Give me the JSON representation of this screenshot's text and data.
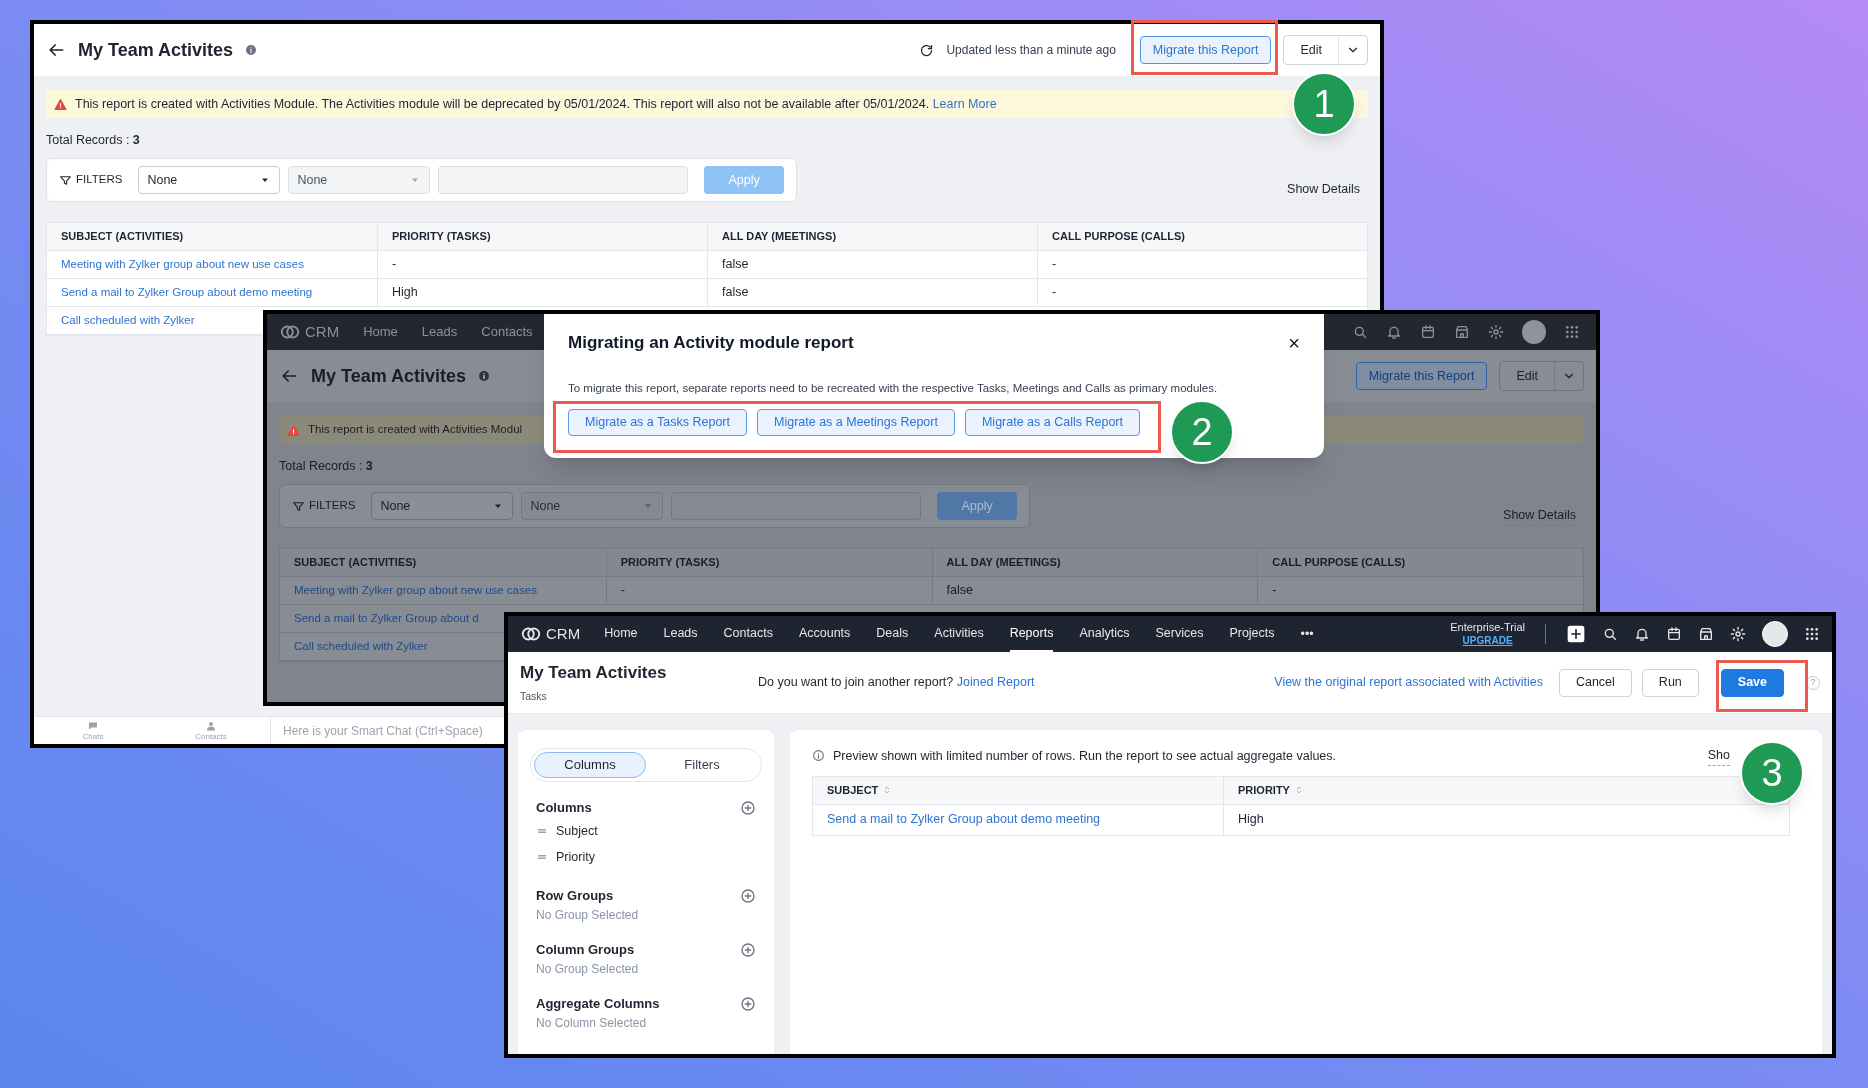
{
  "window_1": {
    "title": "My Team Activites",
    "status": "Updated less than a minute ago",
    "migrate_button": "Migrate this Report",
    "edit_button": "Edit",
    "warning": {
      "text": "This report is created with Activities Module. The Activities module will be deprecated by 05/01/2024. This report will also not be available after 05/01/2024.",
      "link": "Learn More"
    },
    "total_records": {
      "label": "Total Records :",
      "value": "3"
    },
    "filters": {
      "label": "FILTERS",
      "selects": [
        {
          "value": "None",
          "disabled": false
        },
        {
          "value": "None",
          "disabled": true
        }
      ],
      "apply": {
        "label": "Apply",
        "disabled": true
      }
    },
    "show_details": "Show Details",
    "table": {
      "columns": [
        "SUBJECT (ACTIVITIES)",
        "PRIORITY (TASKS)",
        "ALL DAY (MEETINGS)",
        "CALL PURPOSE (CALLS)"
      ],
      "rows": [
        [
          "Meeting with Zylker group about new use cases",
          "-",
          "false",
          "-"
        ],
        [
          "Send a mail to Zylker Group about demo meeting",
          "High",
          "false",
          "-"
        ],
        [
          "Call scheduled with Zylker"
        ]
      ]
    },
    "chat_bar": {
      "tabs": [
        "Chats",
        "Contacts"
      ],
      "placeholder": "Here is your Smart Chat (Ctrl+Space)"
    }
  },
  "window_2": {
    "nav": {
      "logo": "CRM",
      "items": [
        "Home",
        "Leads",
        "Contacts"
      ]
    },
    "title": "My Team Activites",
    "migrate_button": "Migrate this Report",
    "edit_button": "Edit",
    "warning": {
      "text": "This report is created with Activities Modul"
    },
    "total_records": {
      "label": "Total Records :",
      "value": "3"
    },
    "filters": {
      "label": "FILTERS",
      "selects": [
        {
          "value": "None",
          "disabled": false
        },
        {
          "value": "None",
          "disabled": true
        }
      ],
      "apply": {
        "label": "Apply",
        "disabled": true
      }
    },
    "show_details": "Show Details",
    "table": {
      "columns": [
        "SUBJECT (ACTIVITIES)",
        "PRIORITY (TASKS)",
        "ALL DAY (MEETINGS)",
        "CALL PURPOSE (CALLS)"
      ],
      "rows": [
        [
          "Meeting with Zylker group about new use cases",
          "-",
          "false",
          "-"
        ],
        [
          "Send a mail to Zylker Group about d"
        ],
        [
          "Call scheduled with Zylker"
        ]
      ]
    },
    "modal": {
      "title": "Migrating an Activity module report",
      "close": "×",
      "text": "To migrate this report, separate reports need to be recreated with the respective Tasks, Meetings and Calls as primary modules.",
      "buttons": [
        "Migrate as a Tasks Report",
        "Migrate as a Meetings Report",
        "Migrate as a Calls Report"
      ]
    }
  },
  "window_3": {
    "nav": {
      "logo": "CRM",
      "items": [
        {
          "label": "Home",
          "selected": false
        },
        {
          "label": "Leads",
          "selected": false
        },
        {
          "label": "Contacts",
          "selected": false
        },
        {
          "label": "Accounts",
          "selected": false
        },
        {
          "label": "Deals",
          "selected": false
        },
        {
          "label": "Activities",
          "selected": false
        },
        {
          "label": "Reports",
          "selected": true
        },
        {
          "label": "Analytics",
          "selected": false
        },
        {
          "label": "Services",
          "selected": false
        },
        {
          "label": "Projects",
          "selected": false
        }
      ],
      "more": "•••",
      "plan": "Enterprise-Trial",
      "upgrade": "UPGRADE"
    },
    "title": "My Team Activites",
    "subtitle": "Tasks",
    "prompt": {
      "text": "Do you want to join another report?",
      "link": "Joined Report"
    },
    "original_link": "View the original report associated with Activities",
    "buttons": [
      {
        "label": "Cancel",
        "kind": "secondary"
      },
      {
        "label": "Run",
        "kind": "secondary"
      },
      {
        "label": "Save",
        "kind": "primary"
      }
    ],
    "help": "?",
    "sidebar": {
      "tabs": [
        {
          "label": "Columns",
          "selected": true
        },
        {
          "label": "Filters",
          "selected": false
        }
      ],
      "sections": [
        {
          "title": "Columns",
          "items": [
            "Subject",
            "Priority"
          ]
        },
        {
          "title": "Row Groups",
          "empty": "No Group Selected"
        },
        {
          "title": "Column Groups",
          "empty": "No Group Selected"
        },
        {
          "title": "Aggregate Columns",
          "empty": "No Column Selected"
        }
      ]
    },
    "notice": "Preview shown with limited number of rows. Run the report to see actual aggregate values.",
    "show_details": "Sho",
    "table": {
      "columns": [
        "SUBJECT",
        "PRIORITY"
      ],
      "rows": [
        [
          "Send a mail to Zylker Group about demo meeting",
          "High"
        ]
      ]
    }
  },
  "callouts": [
    {
      "label": "1"
    },
    {
      "label": "2"
    },
    {
      "label": "3"
    }
  ]
}
